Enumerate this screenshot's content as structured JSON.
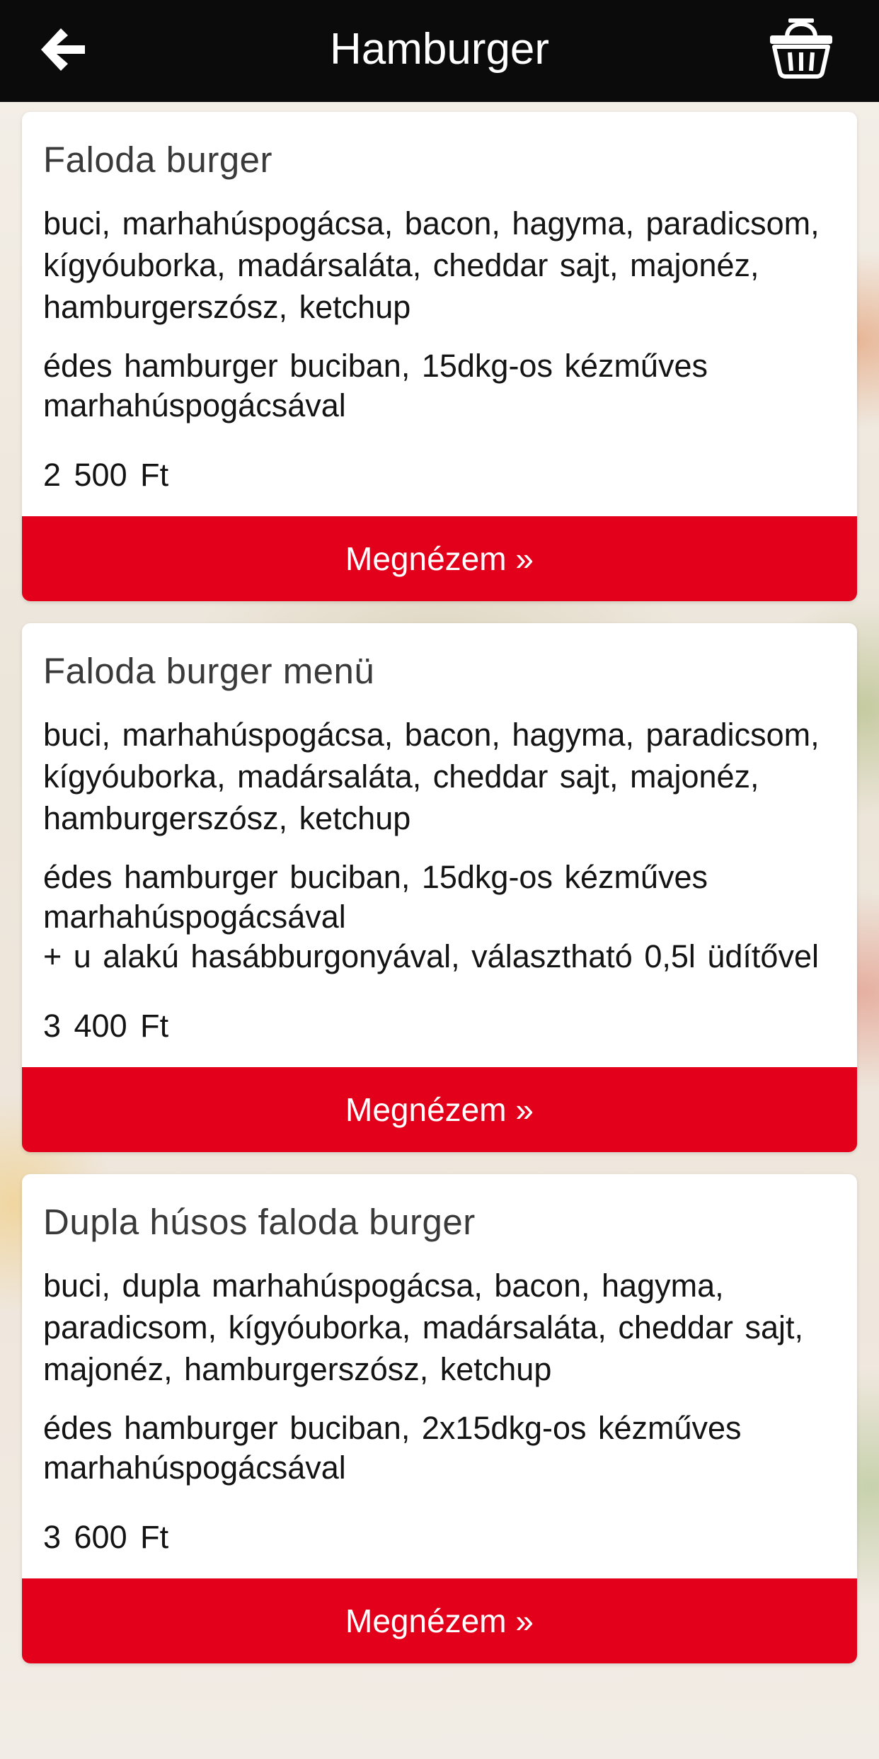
{
  "header": {
    "title": "Hamburger",
    "back_icon": "arrow-left-icon",
    "cart_icon": "basket-icon"
  },
  "theme": {
    "header_bg": "#0b0b0b",
    "accent": "#e2001a",
    "card_bg": "#ffffff"
  },
  "products": [
    {
      "name": "Faloda burger",
      "ingredients": "buci, marhahúspogácsa, bacon, hagyma, paradicsom, kígyóuborka, madársaláta, cheddar sajt, majonéz, hamburgerszósz, ketchup",
      "description_lines": [
        "édes hamburger buciban, 15dkg-os kézműves marhahúspogácsával"
      ],
      "price": "2 500 Ft",
      "button_label": "Megnézem »"
    },
    {
      "name": "Faloda burger menü",
      "ingredients": "buci, marhahúspogácsa, bacon, hagyma, paradicsom, kígyóuborka, madársaláta, cheddar sajt, majonéz, hamburgerszósz, ketchup",
      "description_lines": [
        "édes hamburger buciban, 15dkg-os kézműves marhahúspogácsával",
        "+ u alakú hasábburgonyával, választható 0,5l üdítővel"
      ],
      "price": "3 400 Ft",
      "button_label": "Megnézem »"
    },
    {
      "name": "Dupla húsos faloda burger",
      "ingredients": "buci, dupla marhahúspogácsa, bacon, hagyma, paradicsom, kígyóuborka, madársaláta, cheddar sajt, majonéz, hamburgerszósz, ketchup",
      "description_lines": [
        "édes hamburger buciban, 2x15dkg-os kézműves marhahúspogácsával"
      ],
      "price": "3 600 Ft",
      "button_label": "Megnézem »"
    }
  ]
}
